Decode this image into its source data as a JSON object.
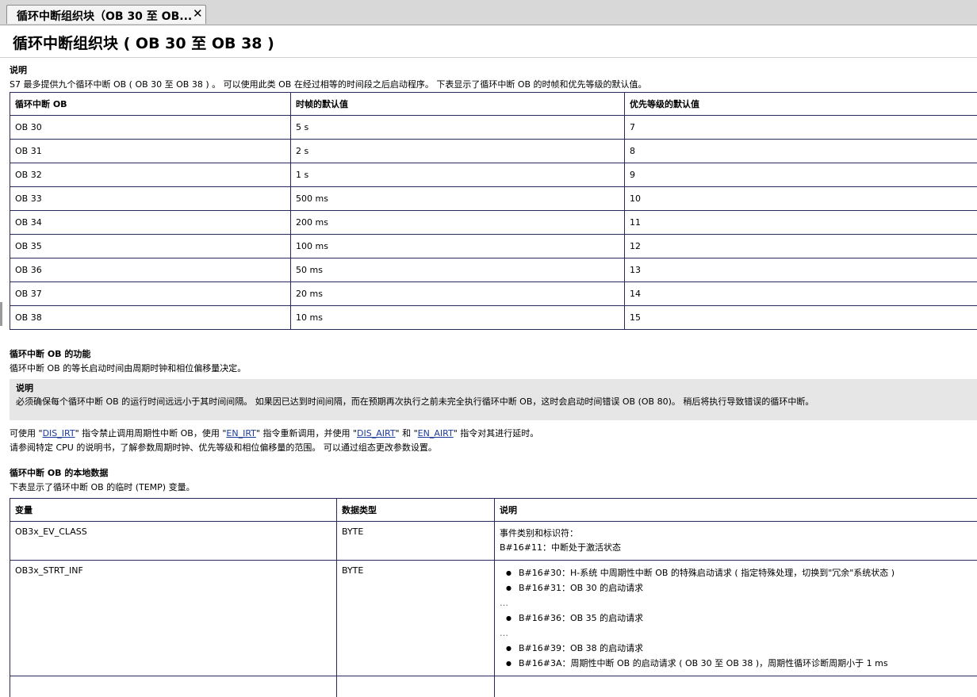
{
  "tab": {
    "label": "循环中断组织块（OB 30 至 OB...",
    "close": "✕"
  },
  "page": {
    "title": "循环中断组织块 ( OB 30 至 OB 38 )"
  },
  "section1": {
    "heading": "说明",
    "text": "S7 最多提供九个循环中断 OB ( OB 30 至 OB 38 ) 。 可以使用此类 OB 在经过相等的时间段之后启动程序。 下表显示了循环中断 OB 的时帧和优先等级的默认值。",
    "headers": [
      "循环中断 OB",
      "时帧的默认值",
      "优先等级的默认值"
    ],
    "rows": [
      [
        "OB 30",
        "5 s",
        "7"
      ],
      [
        "OB 31",
        "2 s",
        "8"
      ],
      [
        "OB 32",
        "1 s",
        "9"
      ],
      [
        "OB 33",
        "500 ms",
        "10"
      ],
      [
        "OB 34",
        "200 ms",
        "11"
      ],
      [
        "OB 35",
        "100 ms",
        "12"
      ],
      [
        "OB 36",
        "50 ms",
        "13"
      ],
      [
        "OB 37",
        "20 ms",
        "14"
      ],
      [
        "OB 38",
        "10 ms",
        "15"
      ]
    ]
  },
  "section2": {
    "heading": "循环中断 OB 的功能",
    "text": "循环中断 OB 的等长启动时间由周期时钟和相位偏移量决定。",
    "note_heading": "说明",
    "note_text": "必须确保每个循环中断 OB 的运行时间远远小于其时间间隔。 如果因已达到时间间隔，而在预期再次执行之前未完全执行循环中断 OB，这时会启动时间错误 OB (OB 80)。 稍后将执行导致错误的循环中断。",
    "line1_a": "可使用 \"",
    "link1": "DIS_IRT",
    "line1_b": "\" 指令禁止调用周期性中断 OB，使用 \"",
    "link2": "EN_IRT",
    "line1_c": "\" 指令重新调用，并使用 \"",
    "link3": "DIS_AIRT",
    "line1_d": "\" 和 \"",
    "link4": "EN_AIRT",
    "line1_e": "\" 指令对其进行延时。",
    "line2": "请参阅特定 CPU 的说明书，了解参数周期时钟、优先等级和相位偏移量的范围。 可以通过组态更改参数设置。"
  },
  "section3": {
    "heading": "循环中断 OB 的本地数据",
    "text": "下表显示了循环中断 OB 的临时 (TEMP) 变量。",
    "headers": [
      "变量",
      "数据类型",
      "说明"
    ],
    "row1": {
      "var": "OB3x_EV_CLASS",
      "type": "BYTE",
      "desc1": "事件类别和标识符：",
      "desc2": "B#16#11：中断处于激活状态"
    },
    "row2": {
      "var": "OB3x_STRT_INF",
      "type": "BYTE",
      "b1": "B#16#30：H-系统 中周期性中断 OB 的特殊启动请求 ( 指定特殊处理，切换到\"冗余\"系统状态 )",
      "b2": "B#16#31：OB 30 的启动请求",
      "e1": "…",
      "b3": "B#16#36：OB 35 的启动请求",
      "e2": "…",
      "b4": "B#16#39：OB 38 的启动请求",
      "b5": "B#16#3A：周期性中断 OB 的启动请求 ( OB 30 至 OB 38 )，周期性循环诊断周期小于 1 ms"
    }
  }
}
